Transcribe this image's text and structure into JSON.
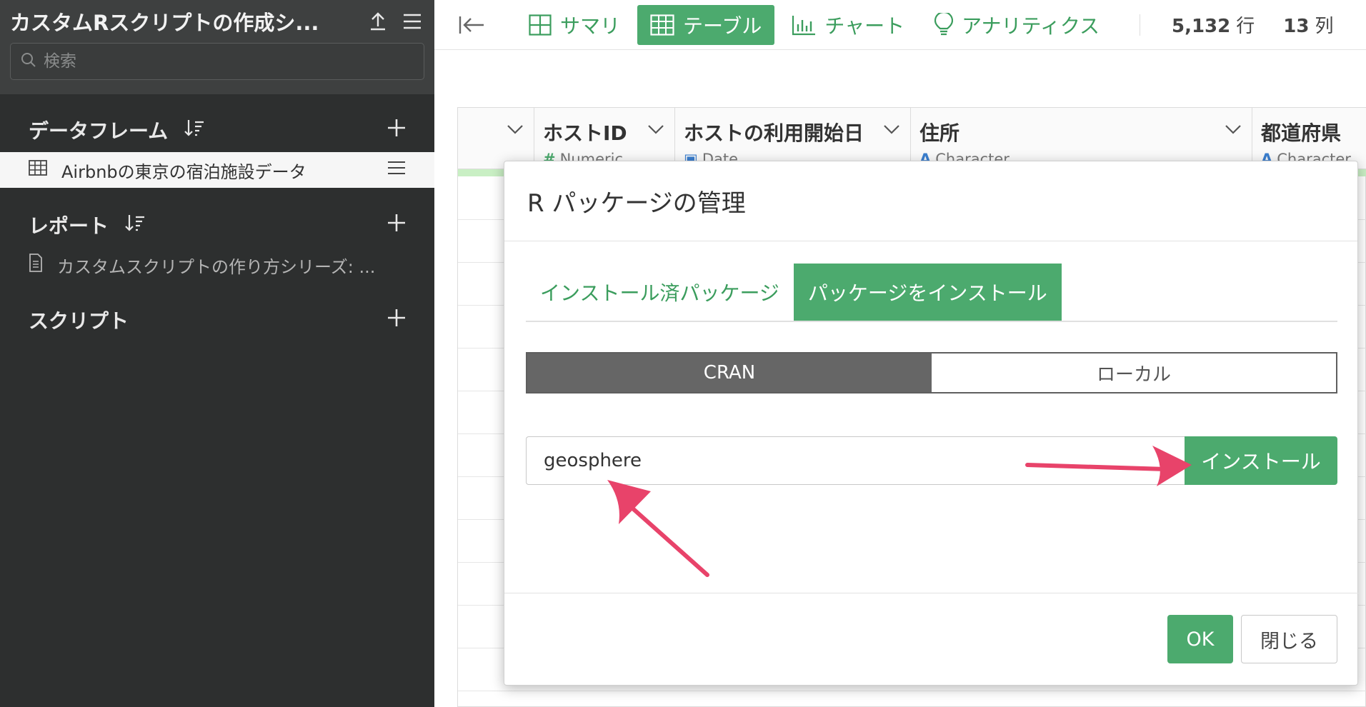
{
  "sidebar": {
    "project_title": "カスタムRスクリプトの作成シ...",
    "search_placeholder": "検索",
    "sections": {
      "dataframes": "データフレーム",
      "reports": "レポート",
      "scripts": "スクリプト"
    },
    "dataframe_item": "Airbnbの東京の宿泊施設データ",
    "report_item": "カスタムスクリプトの作り方シリーズ: ..."
  },
  "toolbar": {
    "tabs": [
      "サマリ",
      "テーブル",
      "チャート",
      "アナリティクス"
    ],
    "active_tab": "テーブル",
    "rows_value": "5,132",
    "rows_unit": "行",
    "cols_value": "13",
    "cols_unit": "列"
  },
  "table": {
    "columns": [
      {
        "name": "ホストID",
        "type": "Numeric",
        "type_mark": "#"
      },
      {
        "name": "ホストの利用開始日",
        "type": "Date",
        "type_mark": "📅"
      },
      {
        "name": "住所",
        "type": "Character",
        "type_mark": "A"
      },
      {
        "name": "都道府県",
        "type": "Character",
        "type_mark": "A"
      }
    ]
  },
  "modal": {
    "title": "R パッケージの管理",
    "tabs": [
      "インストール済パッケージ",
      "パッケージをインストール"
    ],
    "active_tab": "パッケージをインストール",
    "source_options": [
      "CRAN",
      "ローカル"
    ],
    "selected_source": "CRAN",
    "package_input_value": "geosphere",
    "install_button": "インストール",
    "ok_button": "OK",
    "close_button": "閉じる"
  },
  "colors": {
    "accent_green": "#4caa6e",
    "sidebar_bg": "#2d2f2f",
    "annotation_arrow": "#e8436a"
  }
}
